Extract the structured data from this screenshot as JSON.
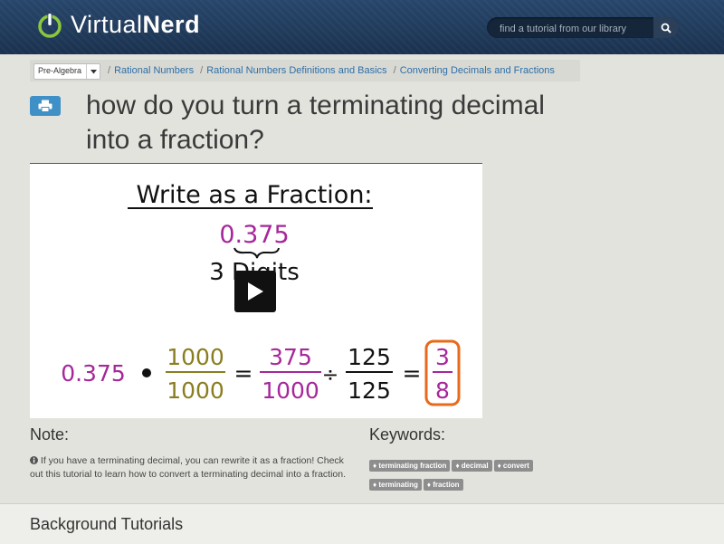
{
  "header": {
    "logo_light": "Virtual",
    "logo_bold": "Nerd",
    "search_placeholder": "find a tutorial from our library",
    "icons": {
      "logo": "power-icon",
      "search": "search-icon"
    }
  },
  "breadcrumb": {
    "subject": "Pre-Algebra",
    "items": [
      "Rational Numbers",
      "Rational Numbers Definitions and Basics",
      "Converting Decimals and Fractions"
    ]
  },
  "page": {
    "title": "how do you turn a terminating decimal into a fraction?"
  },
  "video": {
    "heading": "Write as a Fraction:",
    "decimal": "0.375",
    "digits_label": "3 Digits",
    "equation": {
      "left": "0.375",
      "factor_num": "1000",
      "factor_den": "1000",
      "mid_num": "375",
      "mid_den": "1000",
      "div_num": "125",
      "div_den": "125",
      "result_num": "3",
      "result_den": "8"
    },
    "colors": {
      "purple": "#a6279a",
      "olive": "#8a7d20",
      "orange": "#e8691b"
    }
  },
  "note": {
    "heading": "Note:",
    "text": "If you have a terminating decimal, you can rewrite it as a fraction! Check out this tutorial to learn how to convert a terminating decimal into a fraction."
  },
  "keywords": {
    "heading": "Keywords:",
    "tags": [
      "terminating fraction",
      "decimal",
      "convert",
      "terminating",
      "fraction"
    ]
  },
  "background": {
    "heading": "Background Tutorials"
  },
  "colors": {
    "header_bg": "#1f3a5b",
    "link": "#2c6fa8",
    "print_button": "#3e90c6",
    "logo_green": "#8cc63f"
  }
}
